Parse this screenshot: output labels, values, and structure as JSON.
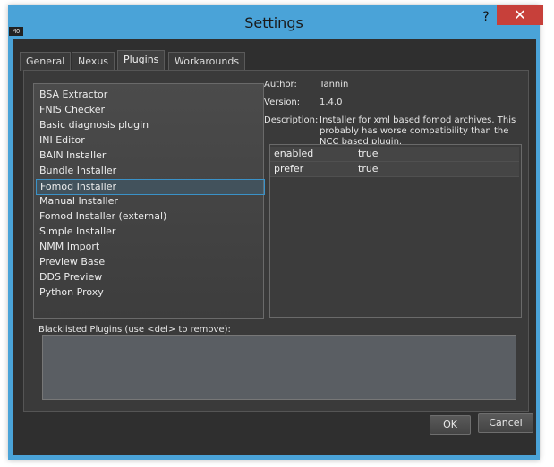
{
  "window": {
    "title": "Settings",
    "app_icon_text": "MO",
    "help_label": "?",
    "close_label": "✕"
  },
  "tabs": [
    {
      "label": "General"
    },
    {
      "label": "Nexus"
    },
    {
      "label": "Plugins"
    },
    {
      "label": "Workarounds"
    }
  ],
  "plugins": {
    "items": [
      "BSA Extractor",
      "FNIS Checker",
      "Basic diagnosis plugin",
      "INI Editor",
      "BAIN Installer",
      "Bundle Installer",
      "Fomod Installer",
      "Manual Installer",
      "Fomod Installer (external)",
      "Simple Installer",
      "NMM Import",
      "Preview Base",
      "DDS Preview",
      "Python Proxy"
    ],
    "selected": "Fomod Installer"
  },
  "info": {
    "author_label": "Author:",
    "author": "Tannin",
    "version_label": "Version:",
    "version": "1.4.0",
    "description_label": "Description:",
    "description_line1": "Installer for xml based fomod archives. This",
    "description_line2": "probably has worse compatibility than the",
    "description_line3": "NCC based plugin."
  },
  "settings": [
    {
      "key": "enabled",
      "value": "true"
    },
    {
      "key": "prefer",
      "value": "true"
    }
  ],
  "blacklist": {
    "label": "Blacklisted Plugins (use <del> to remove):"
  },
  "buttons": {
    "ok": "OK",
    "cancel": "Cancel"
  },
  "colors": {
    "frame": "#4aa3d8",
    "close": "#c7403a",
    "selection": "#3a92c8"
  }
}
